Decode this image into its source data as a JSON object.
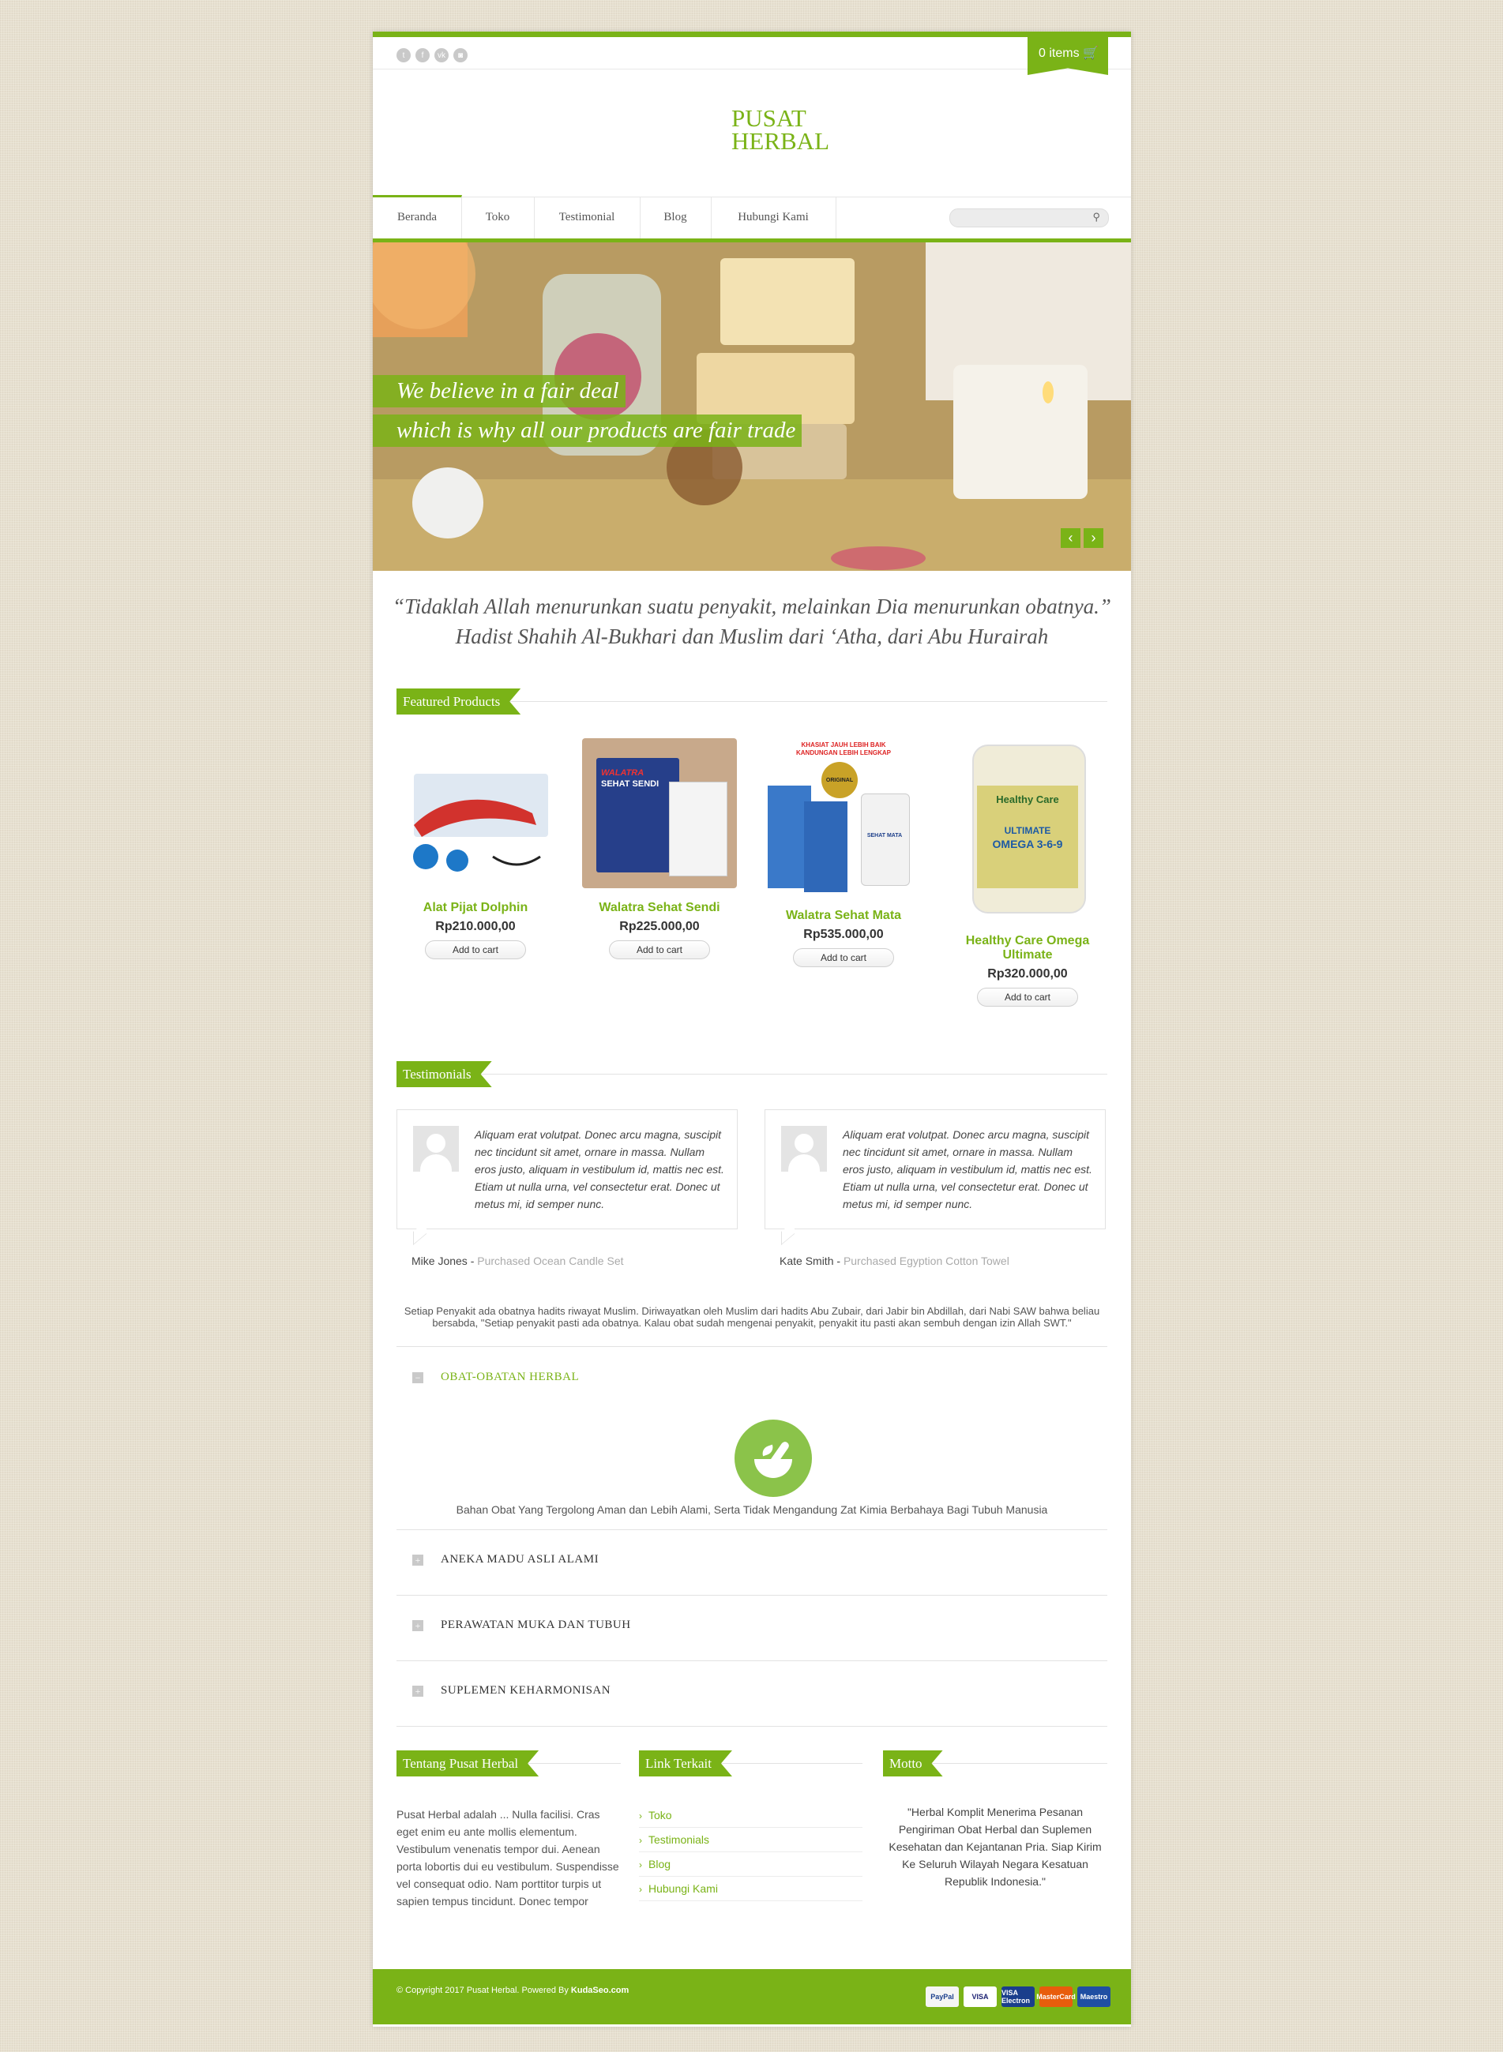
{
  "brand": {
    "line1": "PUSAT",
    "line2": "HERBAL"
  },
  "social": [
    {
      "icon": "twitter-icon",
      "glyph": "t"
    },
    {
      "icon": "facebook-icon",
      "glyph": "f"
    },
    {
      "icon": "vk-icon",
      "glyph": "vk"
    },
    {
      "icon": "instagram-icon",
      "glyph": "◙"
    }
  ],
  "cart": {
    "label": "0 items",
    "icon": "cart-icon"
  },
  "nav": {
    "items": [
      "Beranda",
      "Toko",
      "Testimonial",
      "Blog",
      "Hubungi Kami"
    ],
    "active": "Beranda",
    "search_placeholder": ""
  },
  "slider": {
    "caption_line1": "We believe in a fair deal",
    "caption_line2": "which is why all our products are fair trade"
  },
  "quote": {
    "line1": "“Tidaklah Allah menurunkan suatu penyakit, melainkan Dia menurunkan obatnya.”",
    "line2": "Hadist Shahih Al-Bukhari dan Muslim dari ‘Atha, dari Abu Hurairah"
  },
  "featured": {
    "title": "Featured Products",
    "add_to_cart": "Add to cart",
    "products": [
      {
        "name": "Alat Pijat Dolphin",
        "price": "Rp210.000,00"
      },
      {
        "name": "Walatra Sehat Sendi",
        "price": "Rp225.000,00",
        "img_text1": "WALATRA",
        "img_text2": "SEHAT SENDI"
      },
      {
        "name": "Walatra Sehat Mata",
        "price": "Rp535.000,00",
        "img_text1": "KHASIAT JAUH LEBIH BAIK",
        "img_text2": "KANDUNGAN LEBIH LENGKAP",
        "badge": "ORIGINAL",
        "bottle": "SEHAT MATA"
      },
      {
        "name": "Healthy Care Omega Ultimate",
        "price": "Rp320.000,00",
        "img_text1": "Healthy Care",
        "img_text2": "ULTIMATE",
        "img_text3": "OMEGA 3-6-9"
      }
    ]
  },
  "testimonials": {
    "title": "Testimonials",
    "items": [
      {
        "text": "Aliquam erat volutpat. Donec arcu magna, suscipit nec tincidunt sit amet, ornare in massa. Nullam eros justo, aliquam in vestibulum id, mattis nec est. Etiam ut nulla urna, vel consectetur erat. Donec ut metus mi, id semper nunc.",
        "name": "Mike Jones",
        "sep": " - ",
        "purchase": "Purchased Ocean Candle Set"
      },
      {
        "text": "Aliquam erat volutpat. Donec arcu magna, suscipit nec tincidunt sit amet, ornare in massa. Nullam eros justo, aliquam in vestibulum id, mattis nec est. Etiam ut nulla urna, vel consectetur erat. Donec ut metus mi, id semper nunc.",
        "name": "Kate Smith",
        "sep": " - ",
        "purchase": "Purchased Egyption Cotton Towel"
      }
    ]
  },
  "hadith_paragraph": "Setiap Penyakit ada obatnya hadits riwayat Muslim. Diriwayatkan oleh Muslim dari hadits Abu Zubair, dari Jabir bin Abdillah, dari Nabi SAW bahwa beliau bersabda, \"Setiap penyakit pasti ada obatnya. Kalau obat sudah mengenai penyakit, penyakit itu pasti akan sembuh dengan izin Allah SWT.\"",
  "accordion": {
    "items": [
      {
        "title": "OBAT-OBATAN HERBAL",
        "open": true,
        "toggle": "−",
        "body": "Bahan Obat Yang Tergolong Aman dan Lebih Alami, Serta Tidak Mengandung Zat Kimia Berbahaya Bagi Tubuh Manusia",
        "icon": "mortar-pestle-icon"
      },
      {
        "title": "ANEKA MADU ASLI ALAMI",
        "open": false,
        "toggle": "+"
      },
      {
        "title": "PERAWATAN MUKA DAN TUBUH",
        "open": false,
        "toggle": "+"
      },
      {
        "title": "SUPLEMEN KEHARMONISAN",
        "open": false,
        "toggle": "+"
      }
    ]
  },
  "footer": {
    "about": {
      "title": "Tentang Pusat Herbal",
      "text": "Pusat Herbal adalah ... Nulla facilisi. Cras eget enim eu ante mollis elementum. Vestibulum venenatis tempor dui. Aenean porta lobortis dui eu vestibulum. Suspendisse vel consequat odio. Nam porttitor turpis ut sapien tempus tincidunt. Donec tempor"
    },
    "links": {
      "title": "Link Terkait",
      "items": [
        "Toko",
        "Testimonials",
        "Blog",
        "Hubungi Kami"
      ],
      "chevron": "›"
    },
    "motto": {
      "title": "Motto",
      "text": "\"Herbal Komplit Menerima Pesanan Pengiriman Obat Herbal dan Suplemen Kesehatan dan Kejantanan Pria. Siap Kirim Ke Seluruh Wilayah Negara Kesatuan Republik Indonesia.\""
    },
    "copyright": "© Copyright 2017 Pusat Herbal. Powered By",
    "powered": "KudaSeo.com",
    "cards": [
      {
        "label": "PayPal",
        "bg": "#f5f5f5",
        "fg": "#1a3e8c"
      },
      {
        "label": "VISA",
        "bg": "#ffffff",
        "fg": "#1a1f71"
      },
      {
        "label": "VISA Electron",
        "bg": "#1a3e8c",
        "fg": "#ffffff"
      },
      {
        "label": "MasterCard",
        "bg": "#e85d0c",
        "fg": "#ffffff"
      },
      {
        "label": "Maestro",
        "bg": "#1f4fa3",
        "fg": "#ffffff"
      }
    ]
  },
  "colors": {
    "accent": "#7ab317",
    "background": "#e7e0d0"
  }
}
